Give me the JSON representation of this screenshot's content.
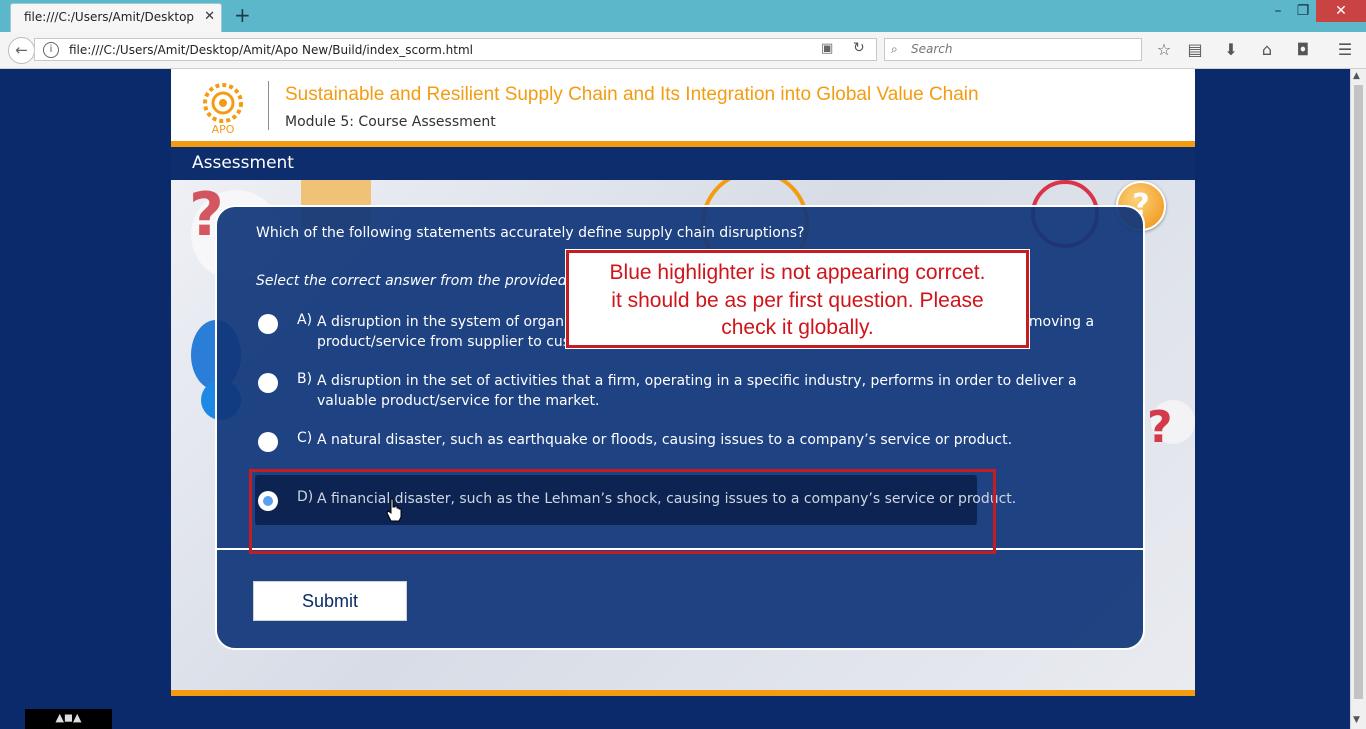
{
  "browser": {
    "tab_title": "file:///C:/Users/Amit/Desktop/Amit/Apo New/Build/index_scorm.html",
    "tab_close": "✕",
    "new_tab": "+",
    "window_controls": {
      "minimize": "–",
      "restore": "❐",
      "close": "✕"
    },
    "url": "file:///C:/Users/Amit/Desktop/Amit/Apo New/Build/index_scorm.html",
    "search_placeholder": "Search",
    "toolbar_icons": [
      "bookmark-star-icon",
      "reading-list-icon",
      "download-icon",
      "home-icon",
      "pocket-icon",
      "menu-icon"
    ]
  },
  "course": {
    "logo_text": "APO",
    "title": "Sustainable and Resilient Supply Chain and Its Integration into Global Value Chain",
    "module": "Module 5: Course Assessment",
    "section": "Assessment",
    "help_label": "?",
    "colors": {
      "accent": "#f39c12",
      "navy": "#0a2a6b",
      "panel": "#10367a",
      "annotation_red": "#c41e22"
    }
  },
  "question": {
    "text": "Which of the following statements accurately define supply chain disruptions?",
    "instruction": "Select the correct answer from the provided options.",
    "options": [
      {
        "letter": "A)",
        "text": "A disruption in the system of organizations, people, activities, information, and resources involved in moving a product/service from supplier to customer."
      },
      {
        "letter": "B)",
        "text": "A disruption in the set of activities that a firm, operating in a specific industry, performs in order to deliver a valuable product/service for the market."
      },
      {
        "letter": "C)",
        "text": "A natural disaster, such as earthquake or floods, causing issues to a company’s service or product."
      },
      {
        "letter": "D)",
        "text": "A financial disaster, such as the Lehman’s shock, causing issues to a company’s service or product.",
        "selected": true
      }
    ],
    "submit_label": "Submit"
  },
  "annotation": {
    "text": "Blue highlighter is not appearing corrcet.\nit should be as per first question. Please\ncheck it globally."
  }
}
